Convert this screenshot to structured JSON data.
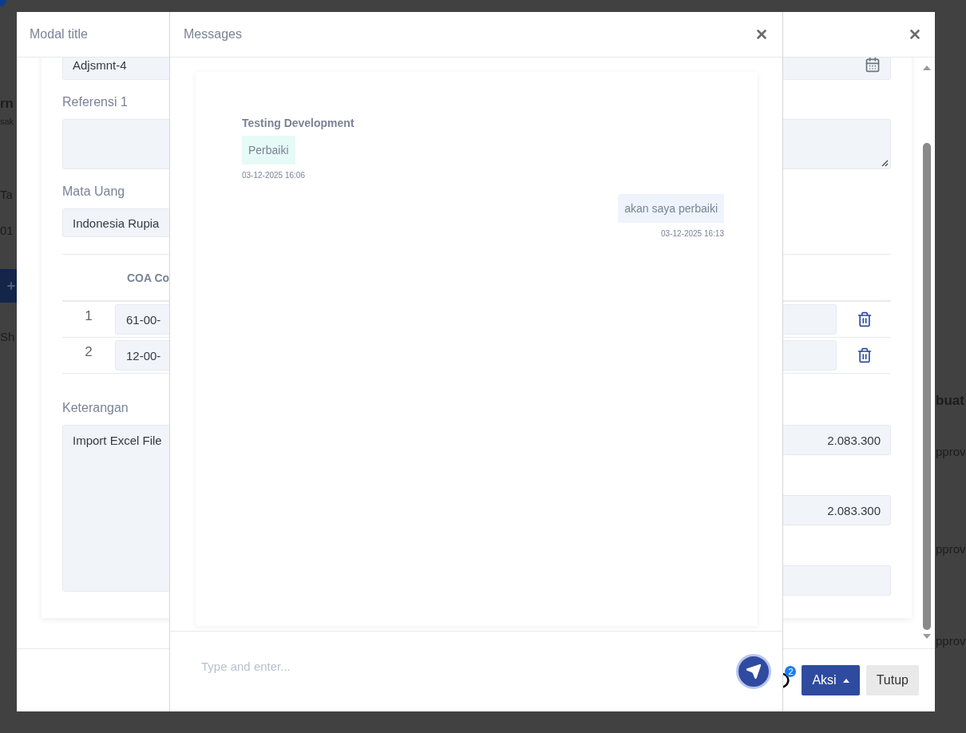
{
  "backdrop": {
    "left": [
      {
        "text": "rn",
        "kind": "heading"
      },
      {
        "text": "sak",
        "kind": "small"
      },
      {
        "text": "Ta",
        "kind": "text"
      },
      {
        "text": "01",
        "kind": "text"
      },
      {
        "text": "Sh",
        "kind": "text"
      }
    ],
    "right": [
      {
        "text": "buat",
        "kind": "heading"
      },
      {
        "text": "pprov",
        "kind": "text"
      },
      {
        "text": "pprov",
        "kind": "text"
      },
      {
        "text": "pprov",
        "kind": "text"
      }
    ]
  },
  "modal": {
    "title": "Modal title"
  },
  "form": {
    "document_no": "Adjsmnt-4",
    "reference_label": "Referensi 1",
    "currency_label": "Mata Uang",
    "currency_value": "Indonesia Rupia",
    "table": {
      "columns": [
        "COA Co"
      ],
      "rows": [
        {
          "number": "1",
          "coa": "61-00-"
        },
        {
          "number": "2",
          "coa": "12-00-"
        }
      ]
    },
    "notes_label": "Keterangan",
    "notes_value": "Import Excel File",
    "totals": [
      "2.083.300",
      "2.083.300"
    ]
  },
  "footer": {
    "chat_badge": "2",
    "buttons": [
      {
        "label": "Aksi",
        "kind": "dropdown"
      },
      {
        "label": "Tutup",
        "kind": "plain"
      }
    ]
  },
  "messages": {
    "title": "Messages",
    "items": [
      {
        "sender": "Testing Development",
        "text": "Perbaiki",
        "time": "03-12-2025 16:06",
        "kind": "received"
      },
      {
        "text": "akan saya perbaiki",
        "time": "03-12-2025 16:13",
        "kind": "sent"
      }
    ],
    "input": {
      "placeholder": "Type and enter..."
    }
  }
}
